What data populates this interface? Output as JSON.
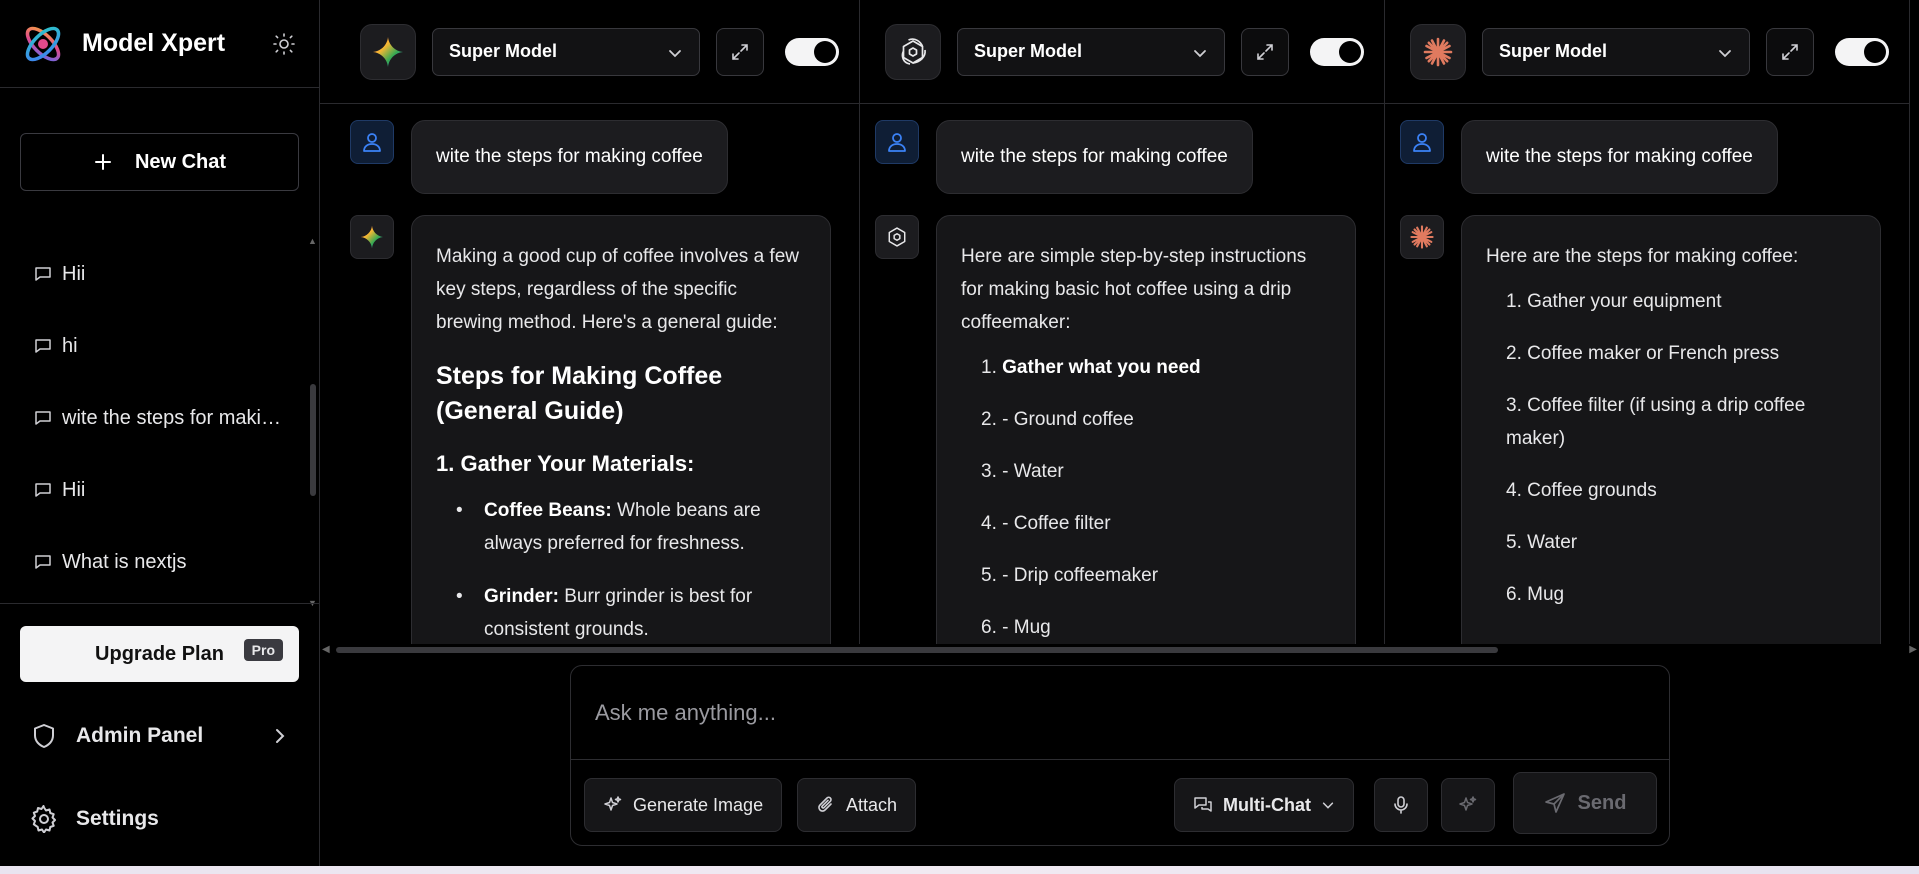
{
  "brand": {
    "name": "Model Xpert"
  },
  "sidebar": {
    "new_chat_label": "New Chat",
    "history": [
      {
        "label": "Hii"
      },
      {
        "label": "hi"
      },
      {
        "label": "wite the steps for making coffee"
      },
      {
        "label": "Hii"
      },
      {
        "label": "What is nextjs"
      }
    ],
    "upgrade_label": "Upgrade Plan",
    "pro_badge": "Pro",
    "admin_label": "Admin Panel",
    "settings_label": "Settings"
  },
  "panels": [
    {
      "model_icon": "gemini-sparkle-icon",
      "model_name": "Super Model",
      "user_message": "wite the steps for making coffee",
      "response": {
        "intro": "Making a good cup of coffee involves a few key steps, regardless of the specific brewing method. Here's a general guide:",
        "heading": "Steps for Making Coffee (General Guide)",
        "subheading": "1. Gather Your Materials:",
        "bullets": [
          {
            "bold": "Coffee Beans:",
            "text": " Whole beans are always preferred for freshness."
          },
          {
            "bold": "Grinder:",
            "text": " Burr grinder is best for consistent grounds."
          }
        ]
      }
    },
    {
      "model_icon": "openai-icon",
      "model_name": "Super Model",
      "user_message": "wite the steps for making coffee",
      "response": {
        "intro": "Here are simple step-by-step instructions for making basic hot coffee using a drip coffeemaker:",
        "steps": [
          {
            "num": "1.",
            "text": "Gather what you need",
            "bold": true
          },
          {
            "num": "2.",
            "text": "- Ground coffee"
          },
          {
            "num": "3.",
            "text": "- Water"
          },
          {
            "num": "4.",
            "text": "- Coffee filter"
          },
          {
            "num": "5.",
            "text": "- Drip coffeemaker"
          },
          {
            "num": "6.",
            "text": "- Mug"
          }
        ]
      }
    },
    {
      "model_icon": "claude-starburst-icon",
      "model_name": "Super Model",
      "user_message": "wite the steps for making coffee",
      "response": {
        "intro": "Here are the steps for making coffee:",
        "steps": [
          {
            "num": "1.",
            "text": "Gather your equipment"
          },
          {
            "num": "2.",
            "text": "Coffee maker or French press"
          },
          {
            "num": "3.",
            "text": "Coffee filter (if using a drip coffee maker)"
          },
          {
            "num": "4.",
            "text": "Coffee grounds"
          },
          {
            "num": "5.",
            "text": "Water"
          },
          {
            "num": "6.",
            "text": "Mug"
          }
        ]
      }
    }
  ],
  "composer": {
    "placeholder": "Ask me anything...",
    "generate_image_label": "Generate Image",
    "attach_label": "Attach",
    "multichat_label": "Multi-Chat",
    "send_label": "Send"
  },
  "colors": {
    "background": "#000000",
    "surface": "#161618",
    "border": "#2d2d31",
    "user_avatar_accent": "#3b82f6",
    "claude_accent": "#e07a5f"
  }
}
